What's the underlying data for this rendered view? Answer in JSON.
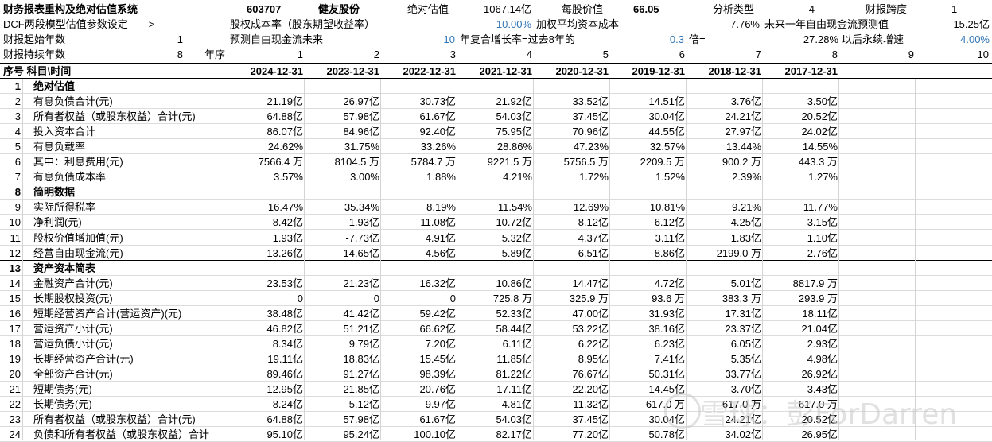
{
  "header": {
    "title": "财务报表重构及绝对估值系统",
    "code": "603707",
    "company": "健友股份",
    "abs_label": "绝对估值",
    "abs_value": "1067.14亿",
    "per_share_label": "每股价值",
    "per_share_value": "66.05",
    "analysis_type_label": "分析类型",
    "analysis_type_value": "4",
    "span_label": "财报跨度",
    "span_value": "1"
  },
  "param_row1": {
    "dcf_label": "DCF两段模型估值参数设定——>",
    "equity_cost_label": "股权成本率（股东期望收益率）",
    "equity_cost_value": "10.00%",
    "wacc_label": "加权平均资本成本",
    "wacc_value": "7.76%",
    "fcf_label": "未来一年自由现金流预测值",
    "fcf_value": "15.25亿"
  },
  "param_row2": {
    "start_label": "财报起始年数",
    "start_value": "1",
    "forecast_label": "预测自由现金流未来",
    "forecast_value": "10",
    "growth_label": "年复合增长率=过去8年的",
    "growth_value": "0.3",
    "times_label": "倍=",
    "times_value": "27.28%",
    "perpetual_label": "以后永续增速",
    "perpetual_value": "4.00%"
  },
  "param_row3": {
    "duration_label": "财报持续年数",
    "duration_value": "8",
    "seq_label": "年序",
    "seq": [
      "1",
      "2",
      "3",
      "4",
      "5",
      "6",
      "7",
      "8",
      "9",
      "10"
    ]
  },
  "table": {
    "head_label": "序号 科目\\时间",
    "dates": [
      "2024-12-31",
      "2023-12-31",
      "2022-12-31",
      "2021-12-31",
      "2020-12-31",
      "2019-12-31",
      "2018-12-31",
      "2017-12-31"
    ],
    "rows": [
      {
        "n": "1",
        "label": "绝对估值",
        "section": true,
        "values": []
      },
      {
        "n": "2",
        "label": "有息负债合计(元)",
        "values": [
          "21.19亿",
          "26.97亿",
          "30.73亿",
          "21.92亿",
          "33.52亿",
          "14.51亿",
          "3.76亿",
          "3.50亿"
        ]
      },
      {
        "n": "3",
        "label": "所有者权益（或股东权益）合计(元)",
        "values": [
          "64.88亿",
          "57.98亿",
          "61.67亿",
          "54.03亿",
          "37.45亿",
          "30.04亿",
          "24.21亿",
          "20.52亿"
        ]
      },
      {
        "n": "4",
        "label": "投入资本合计",
        "values": [
          "86.07亿",
          "84.96亿",
          "92.40亿",
          "75.95亿",
          "70.96亿",
          "44.55亿",
          "27.97亿",
          "24.02亿"
        ]
      },
      {
        "n": "5",
        "label": "有息负载率",
        "values": [
          "24.62%",
          "31.75%",
          "33.26%",
          "28.86%",
          "47.23%",
          "32.57%",
          "13.44%",
          "14.55%"
        ]
      },
      {
        "n": "6",
        "label": "其中：利息费用(元)",
        "values": [
          "7566.4 万",
          "8104.5 万",
          "5784.7 万",
          "9221.5 万",
          "5756.5 万",
          "2209.5 万",
          "900.2 万",
          "443.3 万"
        ]
      },
      {
        "n": "7",
        "label": "有息负债成本率",
        "values": [
          "3.57%",
          "3.00%",
          "1.88%",
          "4.21%",
          "1.72%",
          "1.52%",
          "2.39%",
          "1.27%"
        ]
      },
      {
        "n": "8",
        "label": "简明数据",
        "section": true,
        "values": []
      },
      {
        "n": "9",
        "label": "实际所得税率",
        "values": [
          "16.47%",
          "35.34%",
          "8.19%",
          "11.54%",
          "12.69%",
          "10.81%",
          "9.21%",
          "11.77%"
        ]
      },
      {
        "n": "10",
        "label": "净利润(元)",
        "values": [
          "8.42亿",
          "-1.93亿",
          "11.08亿",
          "10.72亿",
          "8.12亿",
          "6.12亿",
          "4.25亿",
          "3.15亿"
        ]
      },
      {
        "n": "11",
        "label": "股权价值增加值(元)",
        "values": [
          "1.93亿",
          "-7.73亿",
          "4.91亿",
          "5.32亿",
          "4.37亿",
          "3.11亿",
          "1.83亿",
          "1.10亿"
        ]
      },
      {
        "n": "12",
        "label": "经营自由现金流(元)",
        "values": [
          "13.26亿",
          "14.65亿",
          "4.56亿",
          "5.89亿",
          "-6.51亿",
          "-8.86亿",
          "2199.0 万",
          "-2.76亿"
        ]
      },
      {
        "n": "13",
        "label": "资产资本简表",
        "section": true,
        "values": []
      },
      {
        "n": "14",
        "label": "金融资产合计(元)",
        "values": [
          "23.53亿",
          "21.23亿",
          "16.32亿",
          "10.86亿",
          "14.47亿",
          "4.72亿",
          "5.01亿",
          "8817.9 万"
        ]
      },
      {
        "n": "15",
        "label": "长期股权投资(元)",
        "values": [
          "0",
          "0",
          "0",
          "725.8 万",
          "325.9 万",
          "93.6 万",
          "383.3 万",
          "293.9 万"
        ]
      },
      {
        "n": "16",
        "label": "短期经营资产合计(营运资产)(元)",
        "values": [
          "38.48亿",
          "41.42亿",
          "59.42亿",
          "52.33亿",
          "47.00亿",
          "31.93亿",
          "17.31亿",
          "18.11亿"
        ]
      },
      {
        "n": "17",
        "label": "营运资产小计(元)",
        "values": [
          "46.82亿",
          "51.21亿",
          "66.62亿",
          "58.44亿",
          "53.22亿",
          "38.16亿",
          "23.37亿",
          "21.04亿"
        ]
      },
      {
        "n": "18",
        "label": "营运负债小计(元)",
        "values": [
          "8.34亿",
          "9.79亿",
          "7.20亿",
          "6.11亿",
          "6.22亿",
          "6.23亿",
          "6.05亿",
          "2.93亿"
        ]
      },
      {
        "n": "19",
        "label": "长期经营资产合计(元)",
        "values": [
          "19.11亿",
          "18.83亿",
          "15.45亿",
          "11.85亿",
          "8.95亿",
          "7.41亿",
          "5.35亿",
          "4.98亿"
        ]
      },
      {
        "n": "20",
        "label": "全部资产合计(元)",
        "values": [
          "89.46亿",
          "91.27亿",
          "98.39亿",
          "81.22亿",
          "76.67亿",
          "50.31亿",
          "33.77亿",
          "26.92亿"
        ]
      },
      {
        "n": "21",
        "label": "短期债务(元)",
        "values": [
          "12.95亿",
          "21.85亿",
          "20.76亿",
          "17.11亿",
          "22.20亿",
          "14.45亿",
          "3.70亿",
          "3.43亿"
        ]
      },
      {
        "n": "22",
        "label": "长期债务(元)",
        "values": [
          "8.24亿",
          "5.12亿",
          "9.97亿",
          "4.81亿",
          "11.32亿",
          "617.0 万",
          "617.0 万",
          "617.0 万"
        ]
      },
      {
        "n": "23",
        "label": "所有者权益（或股东权益）合计(元)",
        "values": [
          "64.88亿",
          "57.98亿",
          "61.67亿",
          "54.03亿",
          "37.45亿",
          "30.04亿",
          "24.21亿",
          "20.52亿"
        ]
      },
      {
        "n": "24",
        "label": "负债和所有者权益（或股东权益）合计",
        "values": [
          "95.10亿",
          "95.24亿",
          "100.10亿",
          "82.17亿",
          "77.20亿",
          "50.78亿",
          "34.02亿",
          "26.95亿"
        ]
      }
    ]
  },
  "watermark": "雪球：彭ForDarren"
}
